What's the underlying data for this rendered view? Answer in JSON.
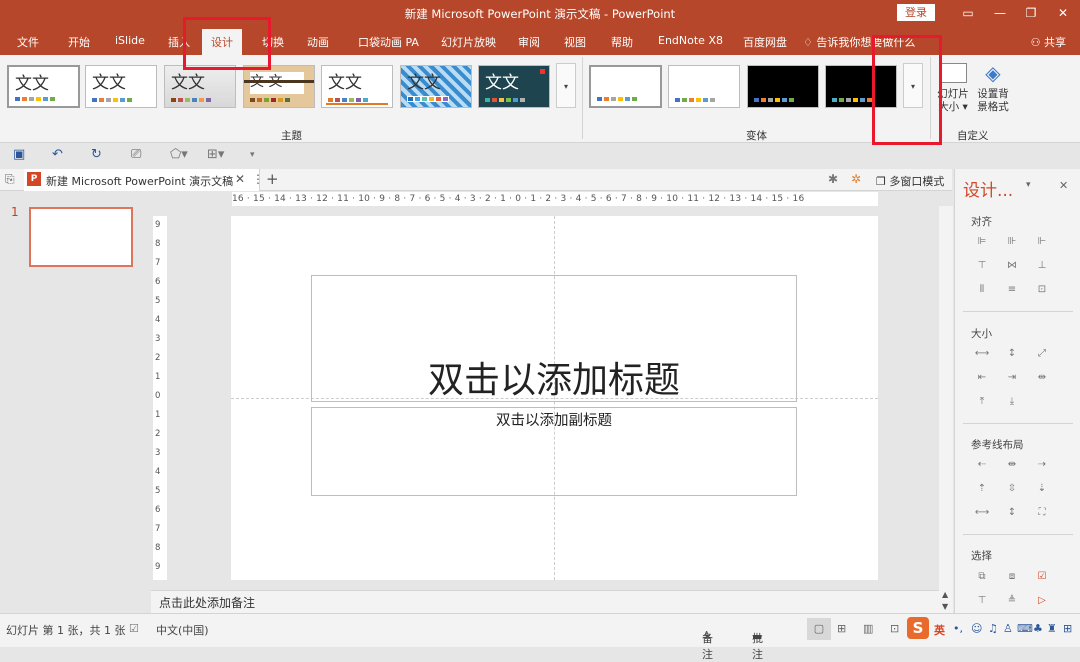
{
  "window": {
    "title": "新建 Microsoft PowerPoint 演示文稿 - PowerPoint",
    "login_label": "登录",
    "share_label": "共享"
  },
  "menu": {
    "tabs": [
      "文件",
      "开始",
      "iSlide",
      "插入",
      "设计",
      "切换",
      "动画",
      "口袋动画 PA",
      "幻灯片放映",
      "审阅",
      "视图",
      "帮助",
      "EndNote X8",
      "百度网盘"
    ],
    "active_tab": "设计",
    "tell_me": "告诉我你想要做什么"
  },
  "ribbon": {
    "theme_sample_text": "文文",
    "theme_sample_text_alt": "文 文",
    "group_themes": "主题",
    "group_variants": "变体",
    "group_customize": "自定义",
    "slide_size_label_1": "幻灯片",
    "slide_size_label_2": "大小 ▾",
    "format_bg_label_1": "设置背",
    "format_bg_label_2": "景格式"
  },
  "doc": {
    "tab_title": "新建 Microsoft  PowerPoint 演示文稿",
    "multi_window": "多窗口模式",
    "ruler_h": "16 ⋅ 15 ⋅ 14 ⋅ 13 ⋅ 12 ⋅ 11 ⋅ 10 ⋅ 9 ⋅ 8 ⋅ 7 ⋅ 6 ⋅ 5 ⋅ 4 ⋅ 3 ⋅ 2 ⋅ 1 ⋅ 0 ⋅ 1 ⋅ 2 ⋅ 3 ⋅ 4 ⋅ 5 ⋅ 6 ⋅ 7 ⋅ 8 ⋅ 9 ⋅ 10 ⋅ 11 ⋅ 12 ⋅ 13 ⋅ 14 ⋅ 15 ⋅ 16",
    "ruler_v": [
      "9",
      "8",
      "7",
      "6",
      "5",
      "4",
      "3",
      "2",
      "1",
      "0",
      "1",
      "2",
      "3",
      "4",
      "5",
      "6",
      "7",
      "8",
      "9"
    ]
  },
  "slide": {
    "number": "1",
    "title_placeholder": "双击以添加标题",
    "subtitle_placeholder": "双击以添加副标题"
  },
  "notes": {
    "placeholder": "点击此处添加备注"
  },
  "design_pane": {
    "title": "设计...",
    "align": "对齐",
    "size": "大小",
    "guides": "参考线布局",
    "select": "选择"
  },
  "status": {
    "slide_info": "幻灯片 第 1 张，共 1 张",
    "language": "中文(中国)",
    "notes_btn": "备注",
    "comments_btn": "批注",
    "ime": "英"
  },
  "colors": {
    "accent": "#b7472a",
    "highlight": "#e8192c"
  }
}
